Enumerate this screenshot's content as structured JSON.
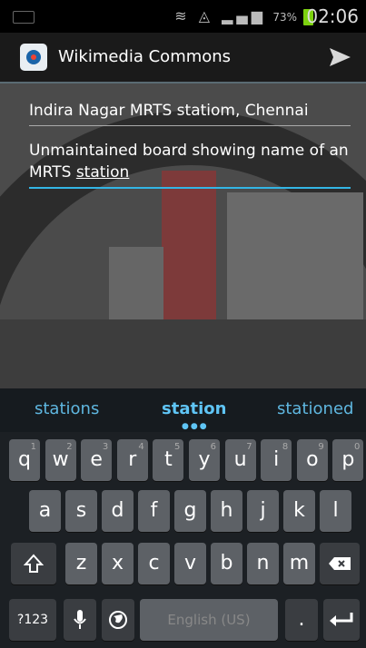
{
  "status_bar": {
    "battery_percent": "73%",
    "time": "02:06",
    "battery_color": "#7cd10f"
  },
  "action_bar": {
    "title": "Wikimedia Commons",
    "send_icon": "send-icon",
    "app_icon": "wikimedia-commons-icon"
  },
  "form": {
    "title_value": "Indira Nagar MRTS statiom, Chennai",
    "description_before": "Unmaintained board showing name of an MRTS ",
    "description_underlined": "station",
    "accent_color": "#33b5e5"
  },
  "suggestions": [
    "stations",
    "station",
    "stationed"
  ],
  "keyboard": {
    "row1": [
      {
        "k": "q",
        "h": "1"
      },
      {
        "k": "w",
        "h": "2"
      },
      {
        "k": "e",
        "h": "3"
      },
      {
        "k": "r",
        "h": "4"
      },
      {
        "k": "t",
        "h": "5"
      },
      {
        "k": "y",
        "h": "6"
      },
      {
        "k": "u",
        "h": "7"
      },
      {
        "k": "i",
        "h": "8"
      },
      {
        "k": "o",
        "h": "9"
      },
      {
        "k": "p",
        "h": "0"
      }
    ],
    "row2": [
      "a",
      "s",
      "d",
      "f",
      "g",
      "h",
      "j",
      "k",
      "l"
    ],
    "row3": [
      "z",
      "x",
      "c",
      "v",
      "b",
      "n",
      "m"
    ],
    "symbols_label": "?123",
    "space_label": "English (US)",
    "period_label": ".",
    "shift_icon": "shift-icon",
    "backspace_icon": "backspace-icon",
    "enter_icon": "enter-icon",
    "mic_icon": "microphone-icon",
    "globe_icon": "globe-icon"
  }
}
